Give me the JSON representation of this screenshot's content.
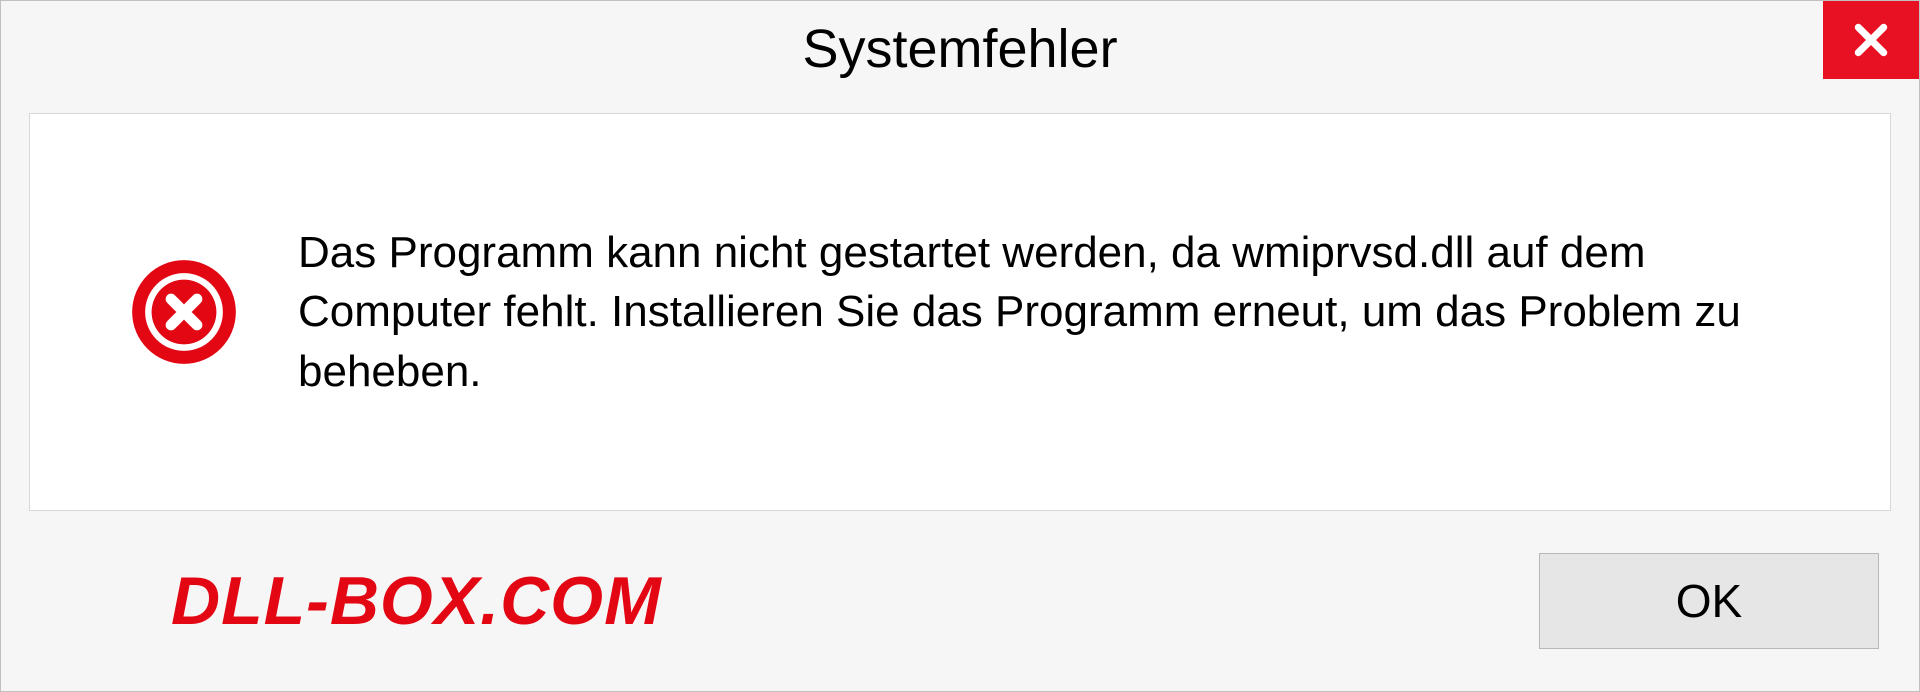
{
  "dialog": {
    "title": "Systemfehler",
    "message": "Das Programm kann nicht gestartet werden, da wmiprvsd.dll auf dem Computer fehlt. Installieren Sie das Programm erneut, um das Problem zu beheben.",
    "ok_label": "OK"
  },
  "watermark": "DLL-BOX.COM"
}
